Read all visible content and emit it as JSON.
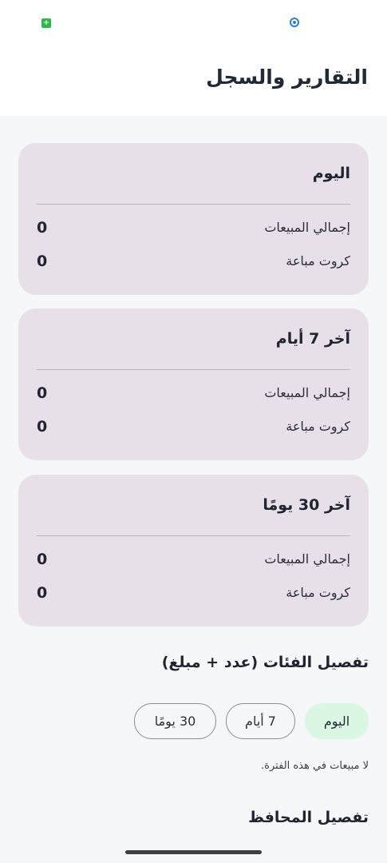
{
  "status_bar": {
    "left_icon": "app-notification-icon",
    "center_icon": "sync-icon"
  },
  "header": {
    "title": "التقارير والسجل"
  },
  "cards": [
    {
      "title": "اليوم",
      "rows": [
        {
          "label": "إجمالي المبيعات",
          "value": "0"
        },
        {
          "label": "كروت مباعة",
          "value": "0"
        }
      ]
    },
    {
      "title": "آخر 7 أيام",
      "rows": [
        {
          "label": "إجمالي المبيعات",
          "value": "0"
        },
        {
          "label": "كروت مباعة",
          "value": "0"
        }
      ]
    },
    {
      "title": "آخر 30 يومًا",
      "rows": [
        {
          "label": "إجمالي المبيعات",
          "value": "0"
        },
        {
          "label": "كروت مباعة",
          "value": "0"
        }
      ]
    }
  ],
  "categories_section": {
    "title": "تفصيل الفئات (عدد + مبلغ)",
    "chips": [
      {
        "label": "اليوم",
        "selected": true
      },
      {
        "label": "7 أيام",
        "selected": false
      },
      {
        "label": "30 يومًا",
        "selected": false
      }
    ],
    "empty_message": "لا مبيعات في هذه الفترة."
  },
  "wallets_section": {
    "title": "تفصيل المحافظ"
  },
  "colors": {
    "card_bg": "#e8e0e8",
    "chip_selected_bg": "#d9f7e3",
    "page_bg": "#f5f7f8"
  }
}
